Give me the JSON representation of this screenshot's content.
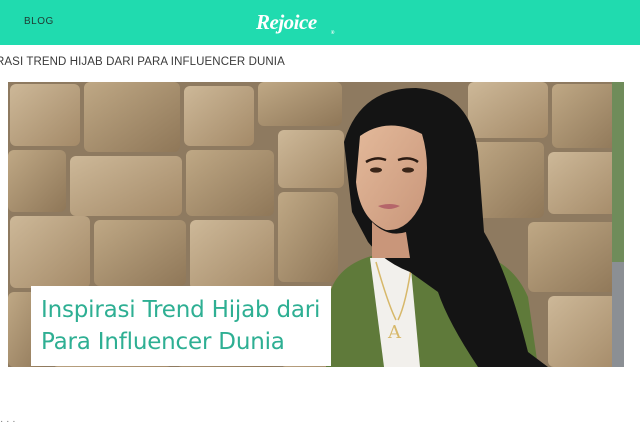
{
  "header": {
    "blog_link": "BLOG",
    "logo_text": "Rejoice",
    "logo_mark": "®",
    "background_color": "#20dbaf"
  },
  "breadcrumb": {
    "text": "RASI TREND HIJAB DARI PARA INFLUENCER DUNIA"
  },
  "hero": {
    "image_subject": "woman-in-black-hijab-stone-wall-photo",
    "title_line1": "Inspirasi Trend Hijab dari",
    "title_line2": "Para Influencer Dunia",
    "title_color": "#2eaf93"
  },
  "footer_fragment": {
    "text": "·  ·  ·"
  }
}
